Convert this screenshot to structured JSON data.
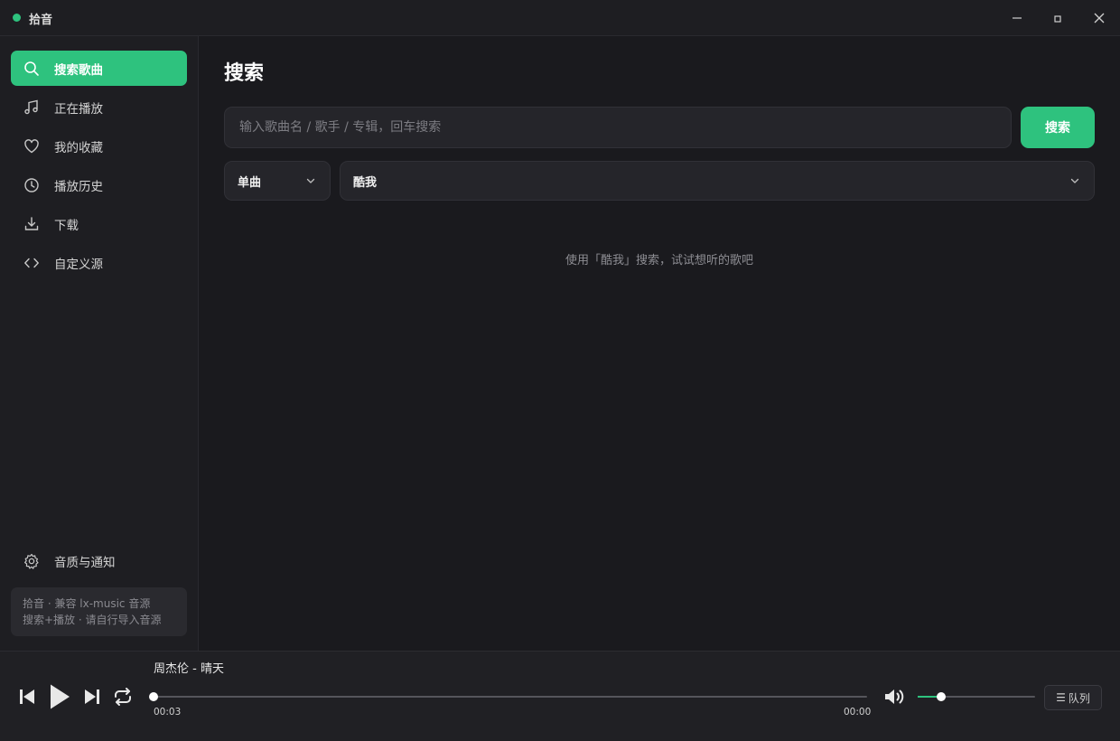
{
  "app": {
    "title": "拾音",
    "status_color": "#2ec27e"
  },
  "window_controls": {
    "icons": [
      "minimize-icon",
      "maximize-icon",
      "close-icon"
    ]
  },
  "colors": {
    "accent": "#2ec27e",
    "background": "#1a1a1e",
    "sidebar": "#1e1e22"
  },
  "sidebar": {
    "items": [
      {
        "label": "搜索歌曲",
        "icon": "search-icon",
        "active": true
      },
      {
        "label": "正在播放",
        "icon": "music-note-icon",
        "active": false
      },
      {
        "label": "我的收藏",
        "icon": "heart-icon",
        "active": false
      },
      {
        "label": "播放历史",
        "icon": "clock-icon",
        "active": false
      },
      {
        "label": "下载",
        "icon": "download-icon",
        "active": false
      },
      {
        "label": "自定义源",
        "icon": "code-icon",
        "active": false
      }
    ],
    "settings": {
      "label": "音质与通知",
      "icon": "gear-icon"
    },
    "note": {
      "line1": "拾音 · 兼容 lx-music 音源",
      "line2": "搜索+播放 · 请自行导入音源"
    }
  },
  "main": {
    "title": "搜索",
    "search": {
      "placeholder": "输入歌曲名 / 歌手 / 专辑，回车搜索",
      "value": "",
      "button_label": "搜索"
    },
    "type_select": {
      "value": "单曲"
    },
    "source_select": {
      "value": "酷我"
    },
    "empty_hint": "使用「酷我」搜索，试试想听的歌吧"
  },
  "player": {
    "track": "周杰伦 - 晴天",
    "time_current": "00:03",
    "time_total": "00:00",
    "progress": 0.0,
    "volume": 0.2,
    "queue_label": "队列",
    "queue_icon": "☰"
  }
}
